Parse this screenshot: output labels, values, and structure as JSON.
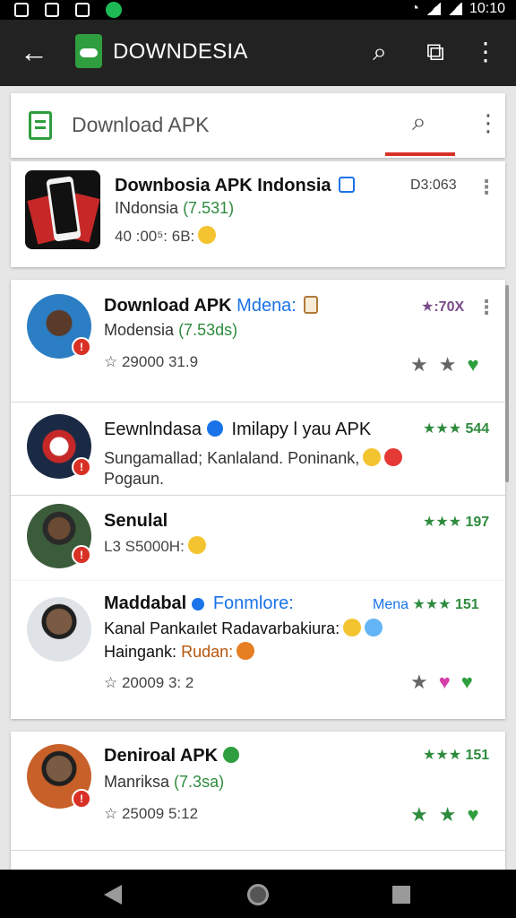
{
  "status_bar": {
    "time": "10:10"
  },
  "app_bar": {
    "title": "DOWNDESIA"
  },
  "search": {
    "placeholder": "Download APK"
  },
  "items": [
    {
      "title": "Downbosia APK Indonsia",
      "sub_prefix": "INdonsia",
      "sub_green": "(7.531)",
      "meta": "40 :00⁵: 6B:",
      "right": "D3:063"
    },
    {
      "title": "Download APK",
      "title_extra": "Mdena:",
      "sub_prefix": "Modensia",
      "sub_green": "(7.53ds)",
      "meta": "☆ 29000  31.9",
      "right": "★:70X"
    },
    {
      "title": "Eewnlndasa",
      "title_extra": "Imilapy l yau APK",
      "sub_line1": "Sungamallad; Kanlaland. Poninank,",
      "sub_line2": "Pogaun.",
      "right": "★★★ 544"
    },
    {
      "title": "Senulal",
      "meta": "L3 S5000H:",
      "right": "★★★ 197"
    },
    {
      "title": "Maddabal",
      "title_extra": "Fonmlore:",
      "right_blue": "Mena",
      "right": "★★★ 151",
      "sub_line1": "Kanal Pankaılet Radavarbakiura:",
      "sub_line2_prefix": "Haingank:",
      "sub_line2_orange": "Rudan:",
      "meta": "☆ 20009  3: 2"
    },
    {
      "title": "Deniroal APK",
      "sub_prefix": "Manriksa",
      "sub_green": "(7.3sa)",
      "meta": "☆ 25009  5:12",
      "right": "★★★ 151"
    }
  ],
  "colors": {
    "accent_green": "#2e9e3e",
    "accent_red": "#d93025",
    "link_blue": "#1a73e8"
  }
}
